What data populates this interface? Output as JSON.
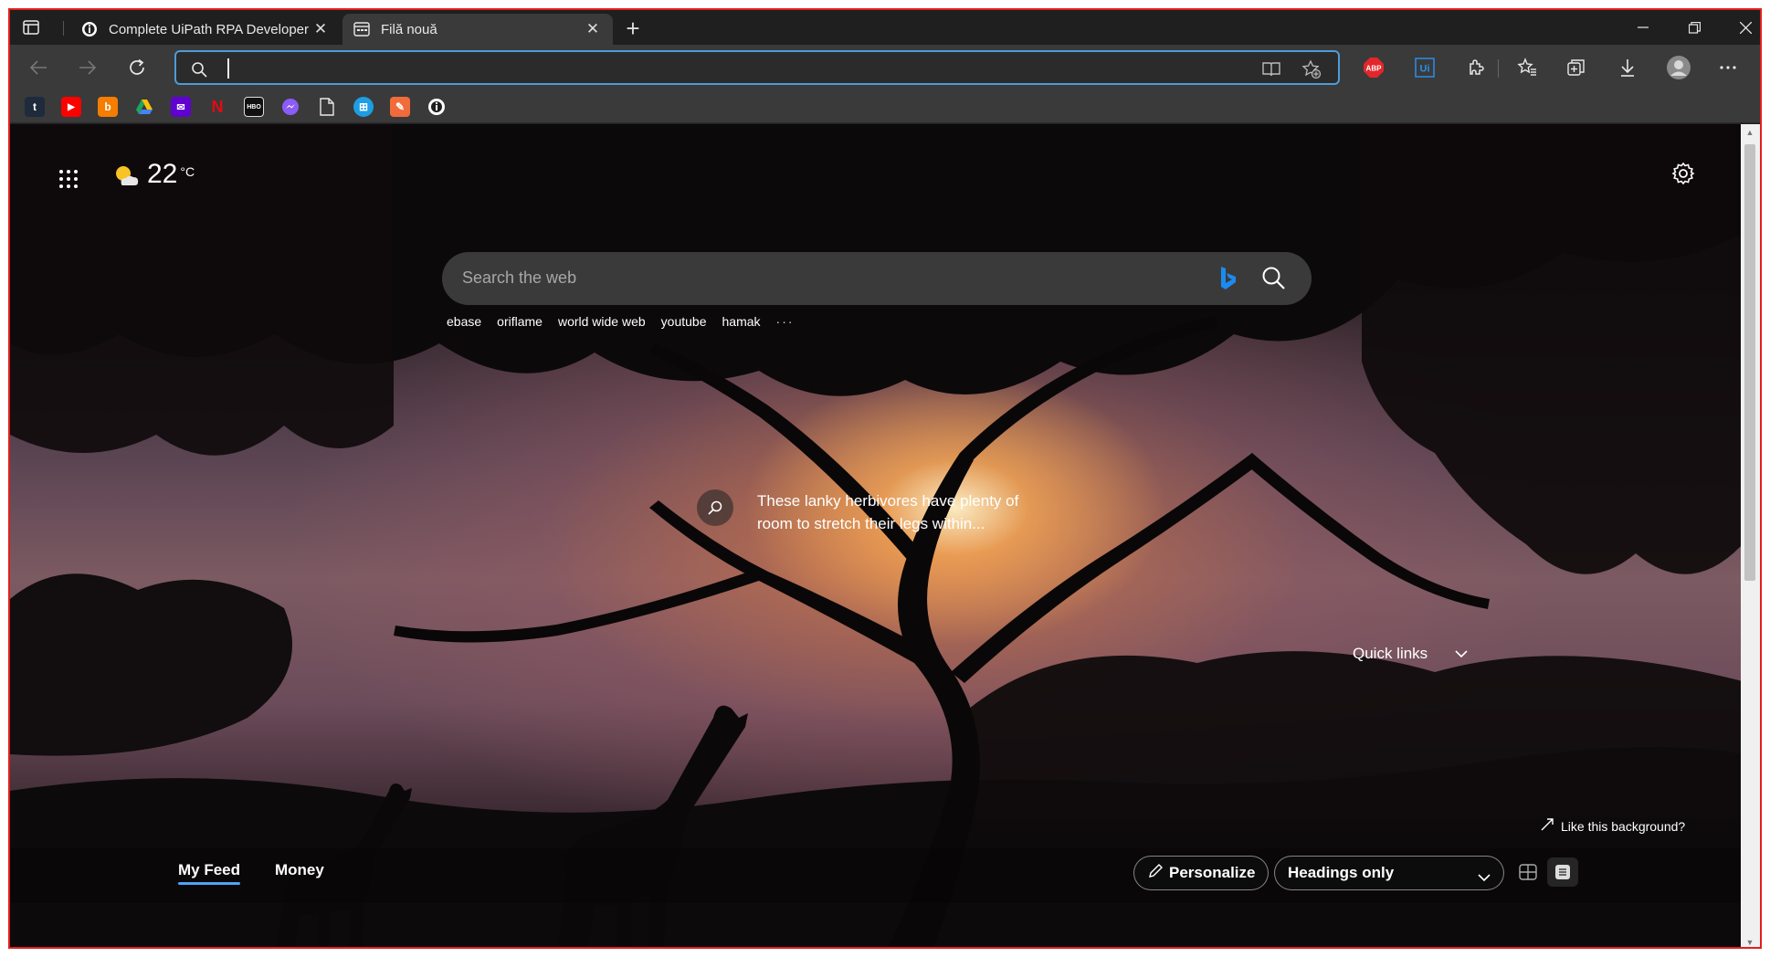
{
  "tabs": [
    {
      "title": "Complete UiPath RPA Developer",
      "active": false
    },
    {
      "title": "Filă nouă",
      "active": true
    }
  ],
  "address_bar": {
    "value": ""
  },
  "favorites": [
    {
      "name": "tumblr-icon",
      "glyph": "t",
      "color": "#1d2b3c"
    },
    {
      "name": "youtube-icon",
      "glyph": "▶",
      "color": "#ff0000"
    },
    {
      "name": "blogger-icon",
      "glyph": "b",
      "color": "#f57d00"
    },
    {
      "name": "google-drive-icon",
      "glyph": "▲",
      "color": "#1fa463"
    },
    {
      "name": "yahoo-mail-icon",
      "glyph": "✉",
      "color": "#6001d2"
    },
    {
      "name": "netflix-icon",
      "glyph": "N",
      "color": "#e50914"
    },
    {
      "name": "hbo-go-icon",
      "glyph": "HBO",
      "color": "#222222"
    },
    {
      "name": "messenger-icon",
      "glyph": "✦",
      "color": "#0a7cff"
    },
    {
      "name": "page-icon",
      "glyph": "",
      "color": "#3a3a3a"
    },
    {
      "name": "windows-app-icon",
      "glyph": "⊞",
      "color": "#1e9de2"
    },
    {
      "name": "draw-app-icon",
      "glyph": "✎",
      "color": "#f26b3a"
    },
    {
      "name": "uipath-academy-icon",
      "glyph": "i",
      "color": "#ffffff"
    }
  ],
  "weather": {
    "temp": "22",
    "unit": "°C"
  },
  "search": {
    "placeholder": "Search the web",
    "trending": [
      "ebase",
      "oriflame",
      "world wide web",
      "youtube",
      "hamak"
    ],
    "more": "···"
  },
  "background": {
    "caption": "These lanky herbivores have plenty of room to stretch their legs within...",
    "like_label": "Like this background?"
  },
  "quick_links": {
    "label": "Quick links"
  },
  "feed": {
    "tabs": [
      "My Feed",
      "Money"
    ],
    "personalize_label": "Personalize",
    "view_select": "Headings only"
  },
  "colors": {
    "accent": "#4f9bd9",
    "window_border": "#e0201c",
    "feed_underline": "#4da3ff"
  }
}
